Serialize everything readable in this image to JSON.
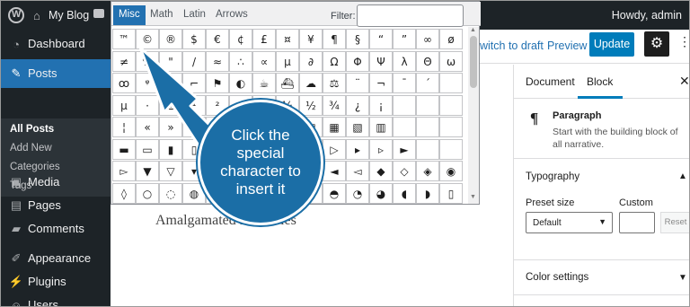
{
  "admin_bar": {
    "site_name": "My Blog",
    "greeting": "Howdy, admin"
  },
  "sidebar": {
    "items": [
      {
        "label": "Dashboard",
        "icon": "dashboard-icon"
      },
      {
        "label": "Posts",
        "icon": "pin-icon",
        "active": true
      },
      {
        "label": "Media",
        "icon": "media-icon"
      },
      {
        "label": "Pages",
        "icon": "pages-icon"
      },
      {
        "label": "Comments",
        "icon": "comments-icon"
      },
      {
        "label": "Appearance",
        "icon": "brush-icon"
      },
      {
        "label": "Plugins",
        "icon": "plug-icon"
      },
      {
        "label": "Users",
        "icon": "users-icon"
      }
    ],
    "submenu": [
      "All Posts",
      "Add New",
      "Categories",
      "Tags"
    ]
  },
  "editor_header": {
    "switch_to_draft": "witch to draft",
    "preview": "Preview",
    "update": "Update"
  },
  "canvas": {
    "text": "Amalgamated Industries"
  },
  "panel": {
    "tab_document": "Document",
    "tab_block": "Block",
    "block_title": "Paragraph",
    "block_desc": "Start with the building block of all narrative.",
    "typography_title": "Typography",
    "preset_label": "Preset size",
    "custom_label": "Custom",
    "preset_value": "Default",
    "reset": "Reset",
    "color_settings": "Color settings"
  },
  "charmap": {
    "tabs": [
      "Misc",
      "Math",
      "Latin",
      "Arrows"
    ],
    "active_tab": "Misc",
    "filter_label": "Filter:",
    "rows": [
      [
        "™",
        "©",
        "®",
        "$",
        "€",
        "¢",
        "£",
        "¤",
        "¥",
        "¶",
        "§",
        "“",
        "”",
        "∞",
        "ø"
      ],
      [
        "≠",
        "%",
        "\"",
        "/",
        "≈",
        "∴",
        "∝",
        "µ",
        "∂",
        "Ω",
        "Φ",
        "Ψ",
        "λ",
        "Θ",
        "ω"
      ],
      [
        "ꝏ",
        "ᵠ",
        "Ͼ",
        "⌐",
        "⚑",
        "◐",
        "☕",
        "⛴",
        "☁",
        "⚖",
        "¨",
        "¬",
        "¯",
        "´",
        ""
      ],
      [
        "µ",
        "·",
        "±",
        "¹",
        "²",
        "³",
        "⅔",
        "¼",
        "½",
        "¾",
        "¿",
        "¡",
        "",
        "",
        ""
      ],
      [
        "¦",
        "«",
        "»",
        "■",
        "□",
        "▪",
        "▫",
        "▩",
        "▨",
        "▦",
        "▧",
        "▥",
        "",
        "",
        ""
      ],
      [
        "▬",
        "▭",
        "▮",
        "▯",
        "▰",
        "▱",
        "▲",
        "△",
        "▶",
        "▷",
        "▸",
        "▹",
        "►",
        "",
        ""
      ],
      [
        "▻",
        "▼",
        "▽",
        "▾",
        "▿",
        "◀",
        "◁",
        "◂",
        "◃",
        "◄",
        "◅",
        "◆",
        "◇",
        "◈",
        "◉"
      ],
      [
        "◊",
        "○",
        "◌",
        "◍",
        "◎",
        "●",
        "◐",
        "◑",
        "◒",
        "◓",
        "◔",
        "◕",
        "◖",
        "◗",
        "▯"
      ]
    ]
  },
  "callout": {
    "text": "Click the special character to insert it",
    "color": "#1b6ea6"
  },
  "colors": {
    "admin_dark": "#1d2327",
    "accent": "#2271b1",
    "update_button": "#007cba"
  }
}
